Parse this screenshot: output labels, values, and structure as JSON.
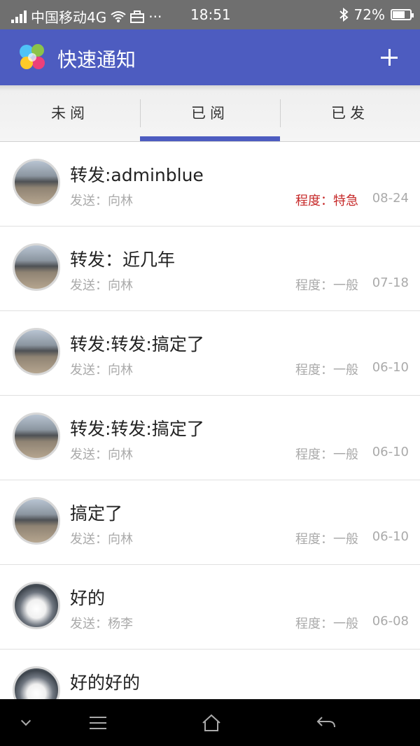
{
  "status_bar": {
    "carrier": "中国移动4G",
    "dots": "···",
    "time": "18:51",
    "battery": "72%",
    "battery_level": 0.72
  },
  "header": {
    "title": "快速通知",
    "accent_color": "#4d5cc0"
  },
  "tabs": [
    {
      "label": "未阅",
      "selected": false
    },
    {
      "label": "已阅",
      "selected": true
    },
    {
      "label": "已发",
      "selected": false
    }
  ],
  "messages": [
    {
      "title": "转发:adminblue",
      "sender": "发送：向林",
      "level": "程度：特急",
      "urgent": true,
      "date": "08-24",
      "avatar": "landscape-avatar"
    },
    {
      "title": "转发：近几年",
      "sender": "发送：向林",
      "level": "程度：一般",
      "urgent": false,
      "date": "07-18",
      "avatar": "landscape-avatar"
    },
    {
      "title": "转发:转发:搞定了",
      "sender": "发送：向林",
      "level": "程度：一般",
      "urgent": false,
      "date": "06-10",
      "avatar": "landscape-avatar"
    },
    {
      "title": "转发:转发:搞定了",
      "sender": "发送：向林",
      "level": "程度：一般",
      "urgent": false,
      "date": "06-10",
      "avatar": "landscape-avatar"
    },
    {
      "title": "搞定了",
      "sender": "发送：向林",
      "level": "程度：一般",
      "urgent": false,
      "date": "06-10",
      "avatar": "landscape-avatar"
    },
    {
      "title": "好的",
      "sender": "发送：杨李",
      "level": "程度：一般",
      "urgent": false,
      "date": "06-08",
      "avatar": "husky-avatar"
    },
    {
      "title": "好的好的",
      "sender": "",
      "level": "",
      "urgent": false,
      "date": "",
      "avatar": "husky-avatar"
    }
  ],
  "colors": {
    "urgent": "#c62828",
    "muted_text": "#aaaaaa"
  },
  "icons": {
    "app_logo": "app-logo-icon",
    "add": "plus-icon",
    "nav_back": "back-arrow-icon",
    "nav_home": "home-icon",
    "nav_menu": "menu-icon",
    "nav_collapse": "chevron-down-icon"
  }
}
